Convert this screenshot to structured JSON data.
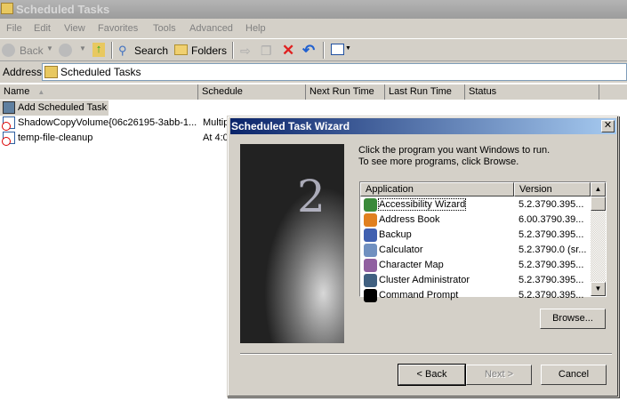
{
  "window": {
    "title": "Scheduled Tasks"
  },
  "menu": [
    "File",
    "Edit",
    "View",
    "Favorites",
    "Tools",
    "Advanced",
    "Help"
  ],
  "toolbar": {
    "back": "Back",
    "search": "Search",
    "folders": "Folders"
  },
  "address": {
    "label": "Address",
    "value": "Scheduled Tasks"
  },
  "columns": [
    "Name",
    "Schedule",
    "Next Run Time",
    "Last Run Time",
    "Status"
  ],
  "rows": [
    {
      "name": "Add Scheduled Task",
      "schedule": ""
    },
    {
      "name": "ShadowCopyVolume{06c26195-3abb-1...",
      "schedule": "Multip"
    },
    {
      "name": "temp-file-cleanup",
      "schedule": "At 4:0"
    }
  ],
  "dialog": {
    "title": "Scheduled Task Wizard",
    "instruction1": "Click the program you want Windows to run.",
    "instruction2": "To see more programs, click Browse.",
    "list_headers": [
      "Application",
      "Version"
    ],
    "apps": [
      {
        "name": "Accessibility Wizard",
        "version": "5.2.3790.395...",
        "color": "#3a8a3a"
      },
      {
        "name": "Address Book",
        "version": "6.00.3790.39...",
        "color": "#e08020"
      },
      {
        "name": "Backup",
        "version": "5.2.3790.395...",
        "color": "#4060b0"
      },
      {
        "name": "Calculator",
        "version": "5.2.3790.0 (sr...",
        "color": "#7090c0"
      },
      {
        "name": "Character Map",
        "version": "5.2.3790.395...",
        "color": "#9060a0"
      },
      {
        "name": "Cluster Administrator",
        "version": "5.2.3790.395...",
        "color": "#406080"
      },
      {
        "name": "Command Prompt",
        "version": "5.2.3790.395...",
        "color": "#000000"
      }
    ],
    "browse": "Browse...",
    "back": "< Back",
    "next": "Next >",
    "cancel": "Cancel"
  }
}
